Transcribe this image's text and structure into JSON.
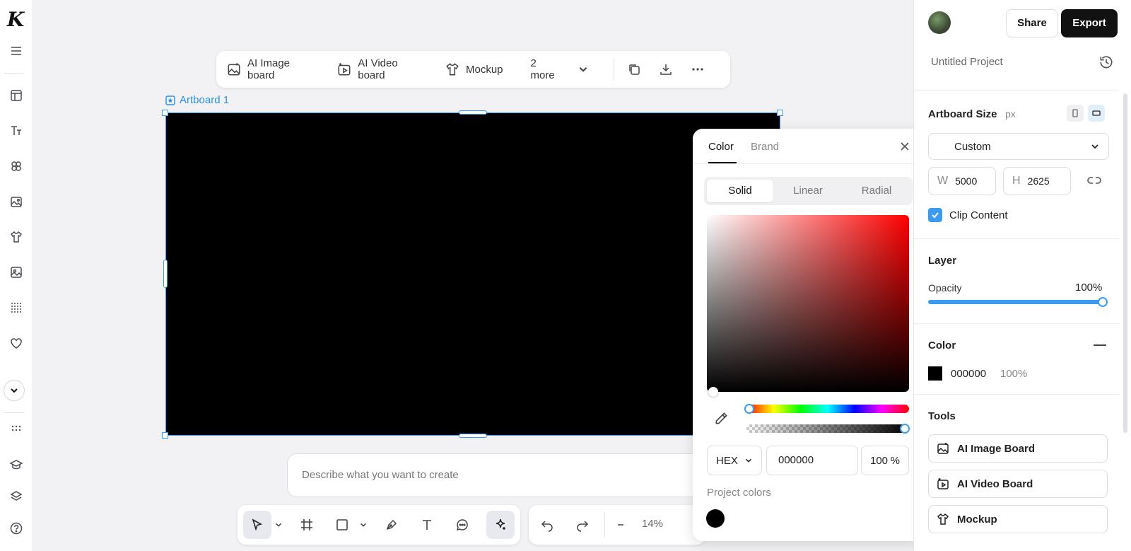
{
  "sidebar": {
    "logo": "K",
    "icons": [
      "menu-icon",
      "layout-icon",
      "text-icon",
      "components-icon",
      "ai-image-icon",
      "mockup-icon",
      "image-icon",
      "grid-dots-icon",
      "heart-icon",
      "chevron-down-icon",
      "apps-icon",
      "learn-icon",
      "layers-icon",
      "help-icon"
    ]
  },
  "top_toolbar": {
    "items": [
      {
        "label": "AI Image board",
        "icon": "ai-image-icon"
      },
      {
        "label": "AI Video board",
        "icon": "ai-video-icon"
      },
      {
        "label": "Mockup",
        "icon": "mockup-icon"
      },
      {
        "label": "2 more",
        "icon": "chevron-down-icon"
      }
    ],
    "actions": [
      "duplicate-icon",
      "download-icon",
      "more-icon"
    ]
  },
  "artboard": {
    "label": "Artboard 1",
    "fill": "#000000"
  },
  "prompt": {
    "placeholder": "Describe what you want to create"
  },
  "bottom_toolbar": {
    "tools": [
      "select-tool",
      "frame-tool",
      "shape-tool",
      "pen-tool",
      "text-tool",
      "comment-tool",
      "ai-tool"
    ],
    "zoom": "14%"
  },
  "color_picker": {
    "tabs": [
      "Color",
      "Brand"
    ],
    "active_tab": "Color",
    "modes": [
      "Solid",
      "Linear",
      "Radial"
    ],
    "active_mode": "Solid",
    "format": "HEX",
    "hex_value": "000000",
    "alpha_value": "100",
    "alpha_unit": "%",
    "project_colors_label": "Project colors",
    "project_colors": [
      "#000000"
    ]
  },
  "right_panel": {
    "share_label": "Share",
    "export_label": "Export",
    "project_name": "Untitled Project",
    "artboard_size": {
      "title": "Artboard Size",
      "unit": "px",
      "preset": "Custom",
      "w_label": "W",
      "w_value": "5000",
      "h_label": "H",
      "h_value": "2625",
      "orientation": "landscape"
    },
    "clip_content_label": "Clip Content",
    "clip_content_checked": true,
    "layer": {
      "title": "Layer",
      "opacity_label": "Opacity",
      "opacity_value": "100%",
      "opacity": 1.0
    },
    "color": {
      "title": "Color",
      "hex": "000000",
      "opacity": "100%",
      "swatch": "#000000"
    },
    "tools": {
      "title": "Tools",
      "items": [
        "AI Image Board",
        "AI Video Board",
        "Mockup"
      ]
    }
  },
  "accent_color": "#3a9bf0"
}
